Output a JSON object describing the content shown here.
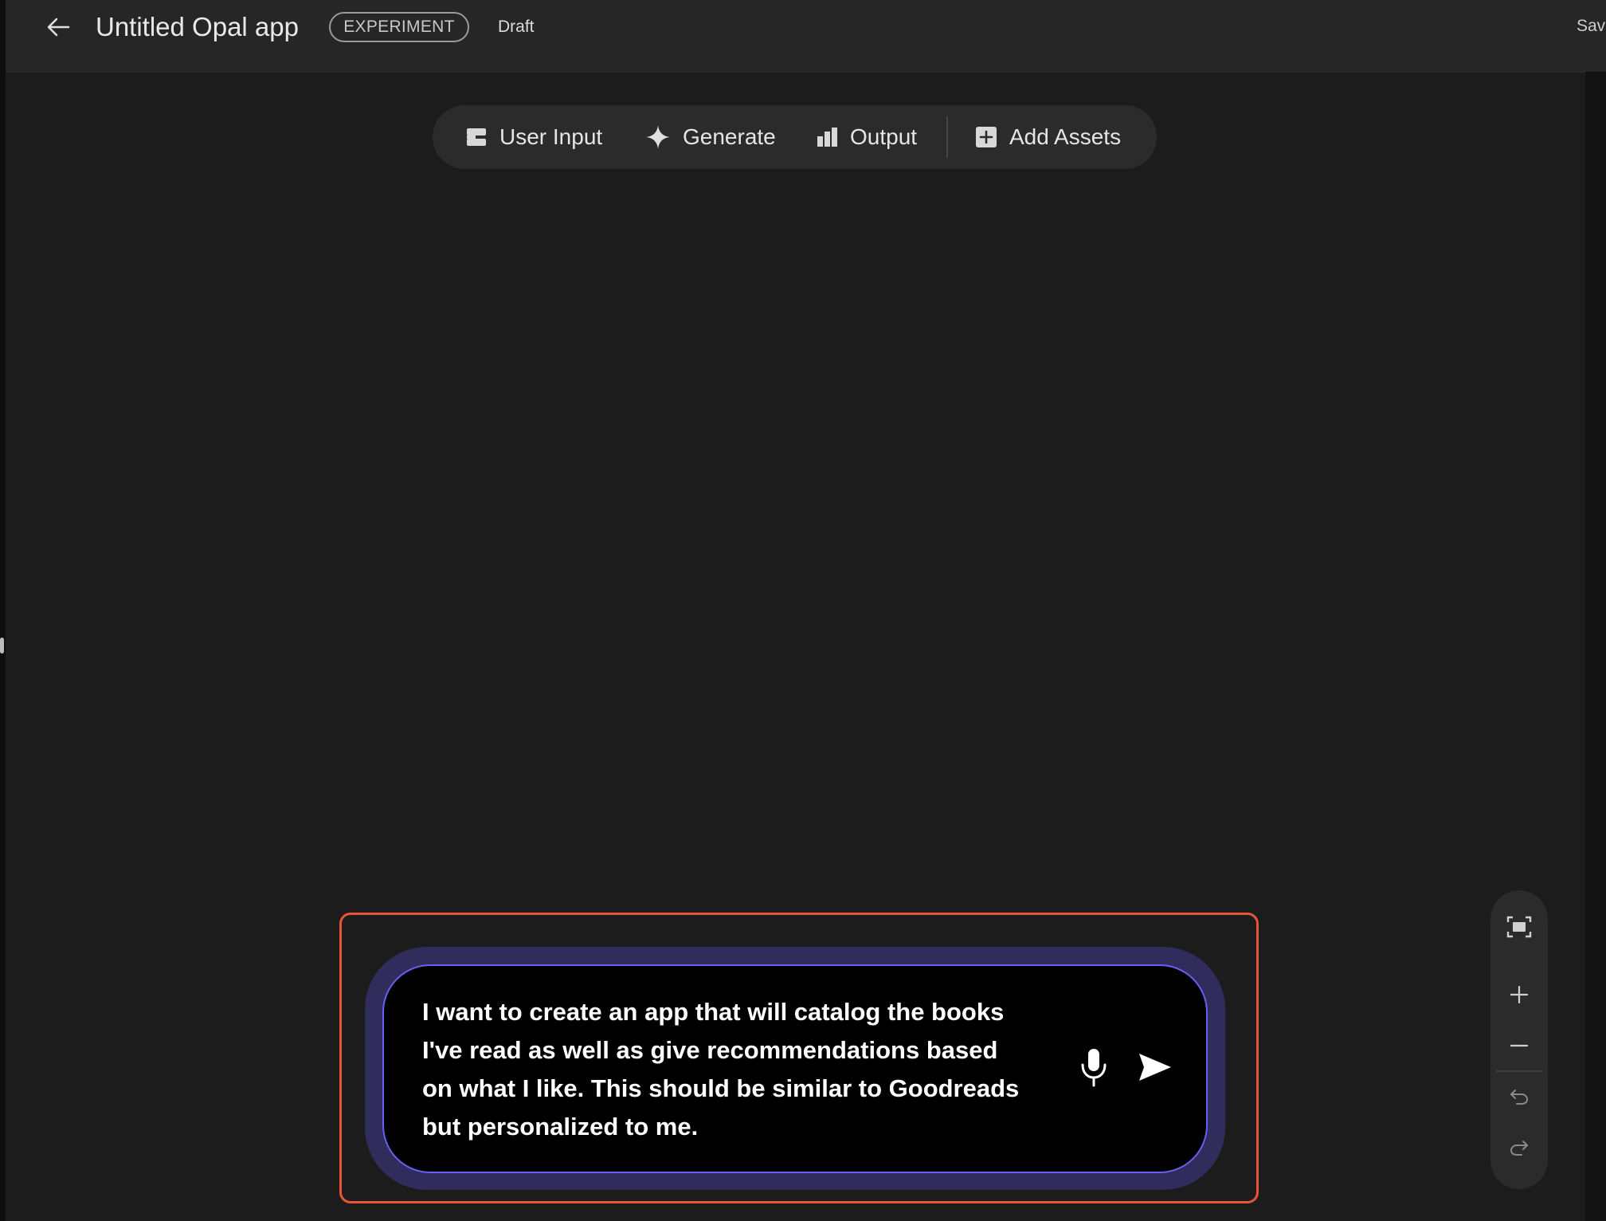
{
  "header": {
    "app_title": "Untitled Opal app",
    "badge": "EXPERIMENT",
    "status": "Draft",
    "save_label": "Save"
  },
  "toolbar": {
    "items": [
      {
        "label": "User Input",
        "icon": "user-input-icon"
      },
      {
        "label": "Generate",
        "icon": "sparkle-icon"
      },
      {
        "label": "Output",
        "icon": "bar-chart-icon"
      },
      {
        "label": "Add Assets",
        "icon": "add-box-icon"
      }
    ]
  },
  "prompt": {
    "lines": [
      "I want to create an app that will catalog the books",
      "I've read as well as give recommendations based",
      "on what I like. This should be similar to Goodreads",
      "but personalized to me."
    ],
    "mic_icon": "microphone-icon",
    "send_icon": "send-icon"
  },
  "zoom_controls": {
    "icons": [
      "fit-screen-icon",
      "zoom-in-icon",
      "zoom-out-icon",
      "undo-icon",
      "redo-icon"
    ]
  },
  "colors": {
    "background": "#1c1c1c",
    "topbar": "#262626",
    "highlight_frame": "#e8543a",
    "prompt_border": "#6a5ff2",
    "prompt_glow": "#302c5c"
  }
}
